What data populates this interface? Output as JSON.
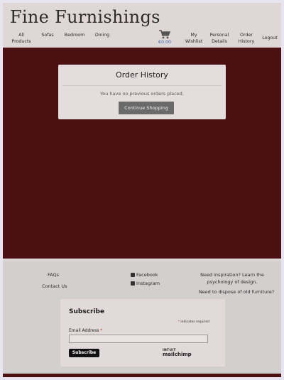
{
  "header": {
    "brand": "Fine Furnishings",
    "nav": [
      {
        "label": "All\nProducts"
      },
      {
        "label": "Sofas"
      },
      {
        "label": "Bedroom"
      },
      {
        "label": "Dining"
      },
      {
        "label": "My\nWishlist"
      },
      {
        "label": "Personal\nDetails"
      },
      {
        "label": "Order\nHistory"
      },
      {
        "label": "Logout"
      }
    ],
    "cart": {
      "icon": "cart-icon",
      "total": "€0.00"
    }
  },
  "main": {
    "title": "Order History",
    "message": "You have no previous orders placed.",
    "button": "Continue Shopping"
  },
  "footer": {
    "faqs": "FAQs",
    "contact": "Contact Us",
    "facebook": "Facebook",
    "instagram": "Instagram",
    "inspiration_line1": "Need inspiration? Learn the",
    "inspiration_line2": "psychology of design.",
    "dispose": "Need to dispose of old furniture?",
    "subscribe": {
      "title": "Subscribe",
      "required_note": "indicates required",
      "email_label": "Email Address",
      "email_value": "",
      "button": "Subscribe",
      "logo_top": "INTUIT",
      "logo_bottom": "mailchimp"
    }
  },
  "colors": {
    "accent": "#4b1112",
    "link": "#3c60b5"
  }
}
